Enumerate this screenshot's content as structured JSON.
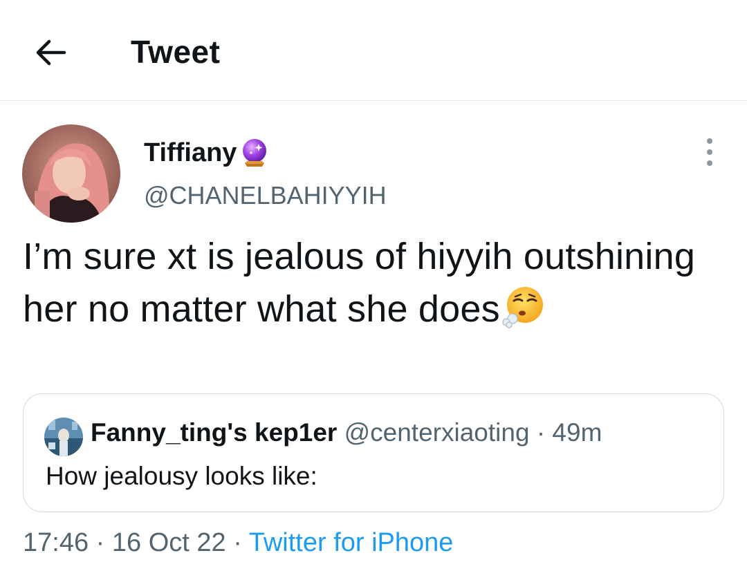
{
  "header": {
    "title": "Tweet",
    "back_icon": "arrow-left-icon"
  },
  "tweet": {
    "display_name": "Tiffiany",
    "name_emoji": "crystal-ball-emoji",
    "handle": "@CHANELBAHIYYIH",
    "text": "I’m sure xt is jealous of hiyyih outshining her no matter what she does",
    "text_emoji": "face-exhaling-emoji",
    "time": "17:46",
    "date": "16 Oct 22",
    "separator": "·",
    "source": "Twitter for iPhone"
  },
  "quote": {
    "display_name": "Fanny_ting's kep1er",
    "handle": "@centerxiaoting",
    "separator": "·",
    "age": "49m",
    "text": "How jealousy looks like:"
  },
  "colors": {
    "text_primary": "#0f1419",
    "text_secondary": "#536471",
    "link": "#1d9bf0",
    "border": "#cfd9de"
  }
}
